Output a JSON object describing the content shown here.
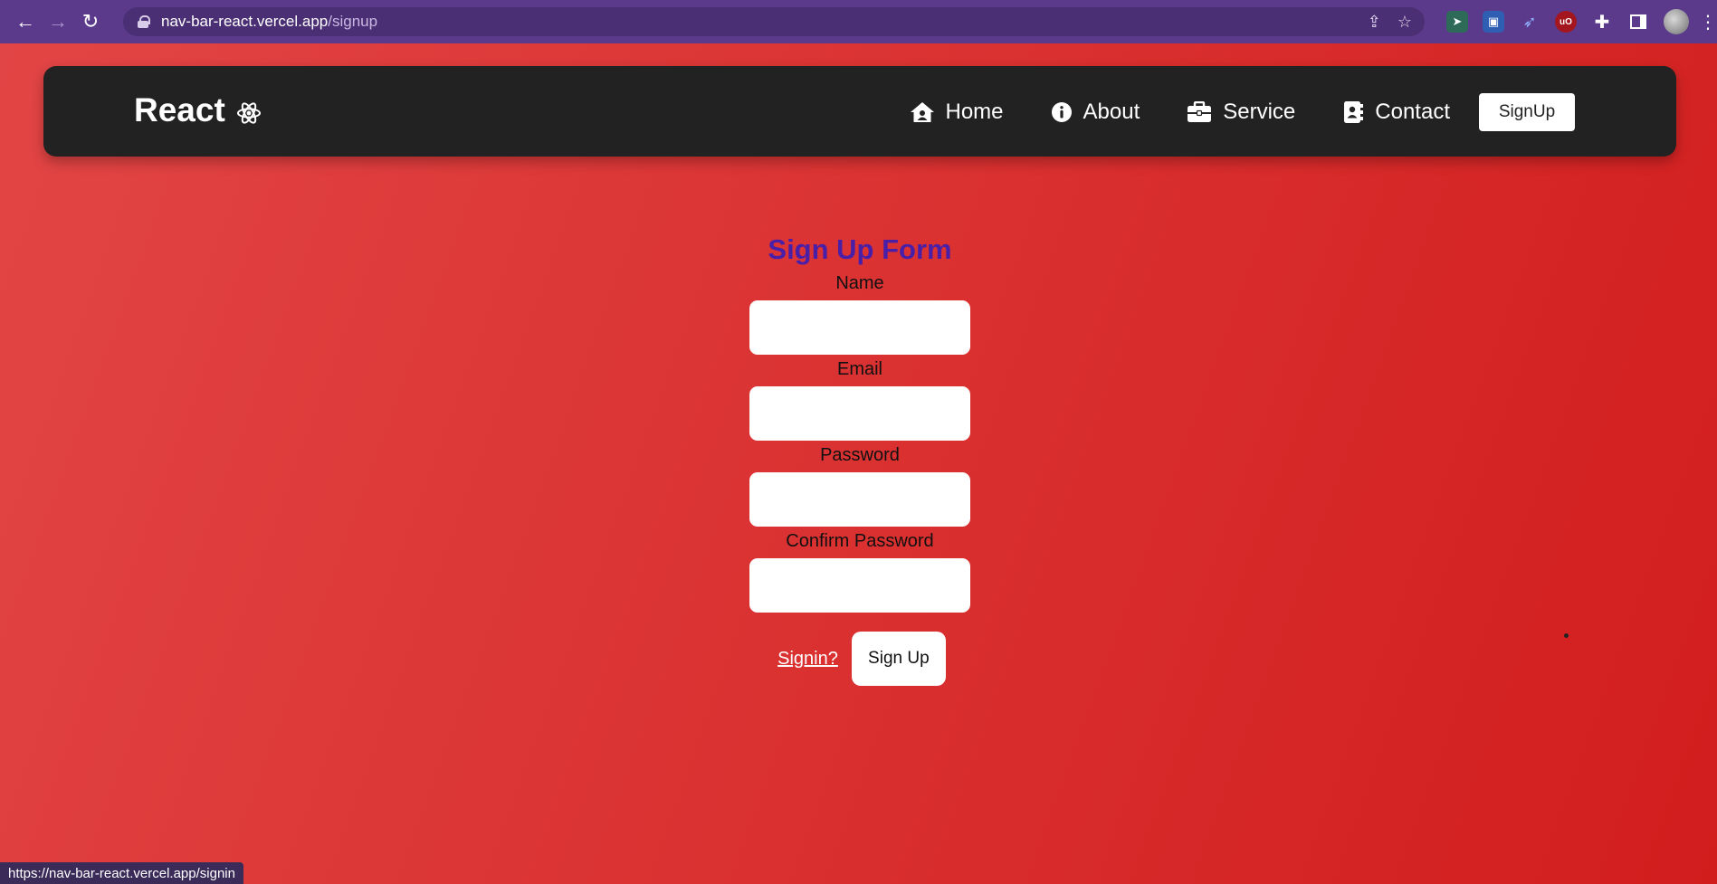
{
  "browser": {
    "url_host": "nav-bar-react.vercel.app",
    "url_path": "/signup",
    "status_url": "https://nav-bar-react.vercel.app/signin"
  },
  "navbar": {
    "brand": "React",
    "links": [
      {
        "label": "Home",
        "icon": "home-icon"
      },
      {
        "label": "About",
        "icon": "info-icon"
      },
      {
        "label": "Service",
        "icon": "briefcase-icon"
      },
      {
        "label": "Contact",
        "icon": "address-book-icon"
      }
    ],
    "signup_button": "SignUp"
  },
  "form": {
    "title": "Sign Up Form",
    "fields": [
      {
        "label": "Name",
        "value": ""
      },
      {
        "label": "Email",
        "value": ""
      },
      {
        "label": "Password",
        "value": ""
      },
      {
        "label": "Confirm Password",
        "value": ""
      }
    ],
    "signin_link": "Signin?",
    "submit_button": "Sign Up"
  },
  "colors": {
    "background": "#d7282a",
    "navbar": "#222222",
    "title": "#4a1fa8",
    "browser_chrome": "#5b3a8c"
  }
}
